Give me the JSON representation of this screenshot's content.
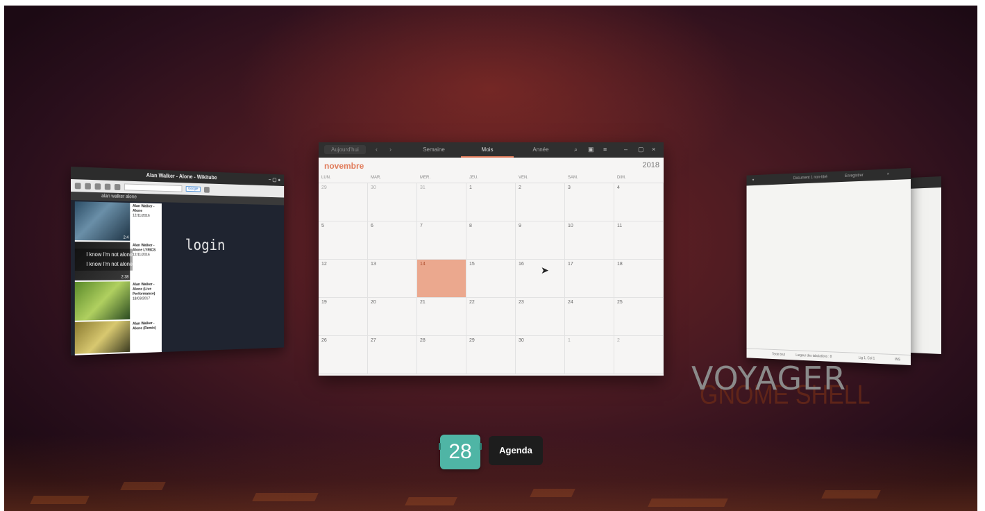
{
  "browser_window": {
    "title": "Alan Walker - Alone - Wikitube",
    "search_query": "alan walker alone",
    "search_button": "Google",
    "login_text": "login",
    "lyrics": [
      "I know I'm not alone",
      "I know I'm not alone"
    ],
    "videos": [
      {
        "title": "Alan Walker - Alone",
        "meta": "12/11/2016",
        "duration": "2:4"
      },
      {
        "title": "Alan Walker - Alone LYRICS",
        "meta": "12/11/2016",
        "duration": "2:38"
      },
      {
        "title": "Alan Walker - Alone (Live Performance)",
        "meta": "18/03/2017",
        "duration": ""
      },
      {
        "title": "Alan Walker - Alone (Remix)",
        "meta": "",
        "duration": ""
      }
    ]
  },
  "calendar_window": {
    "today_button": "Aujourd'hui",
    "tabs": [
      "Semaine",
      "Mois",
      "Année"
    ],
    "active_tab": "Mois",
    "month": "novembre",
    "year": "2018",
    "weekdays": [
      "LUN.",
      "MAR.",
      "MER.",
      "JEU.",
      "VEN.",
      "SAM.",
      "DIM."
    ],
    "weeks": [
      [
        "29",
        "30",
        "31",
        "1",
        "2",
        "3",
        "4"
      ],
      [
        "5",
        "6",
        "7",
        "8",
        "9",
        "10",
        "11"
      ],
      [
        "12",
        "13",
        "14",
        "15",
        "16",
        "17",
        "18"
      ],
      [
        "19",
        "20",
        "21",
        "22",
        "23",
        "24",
        "25"
      ],
      [
        "26",
        "27",
        "28",
        "29",
        "30",
        "1",
        "2"
      ]
    ],
    "today": "14",
    "icons": [
      "search-icon",
      "calendar-icon",
      "menu-icon",
      "minimize-icon",
      "maximize-icon",
      "close-icon"
    ]
  },
  "text_editor_window": {
    "title": "Document 1 non-titré",
    "save_button": "Enregistrer",
    "status_mode": "Texte brut",
    "status_tab": "Largeur des tabulations : 8",
    "status_position": "Lig 1, Col 1",
    "status_ins": "INS"
  },
  "branding": {
    "voyager": "VOYAGER",
    "gnome_shell": "GNOME SHELL"
  },
  "switcher": {
    "icon_label": "28",
    "app_name": "Agenda"
  },
  "colors": {
    "accent": "#e07b5a",
    "today_cell": "#eba88e",
    "switcher_icon": "#4fb5a5"
  }
}
